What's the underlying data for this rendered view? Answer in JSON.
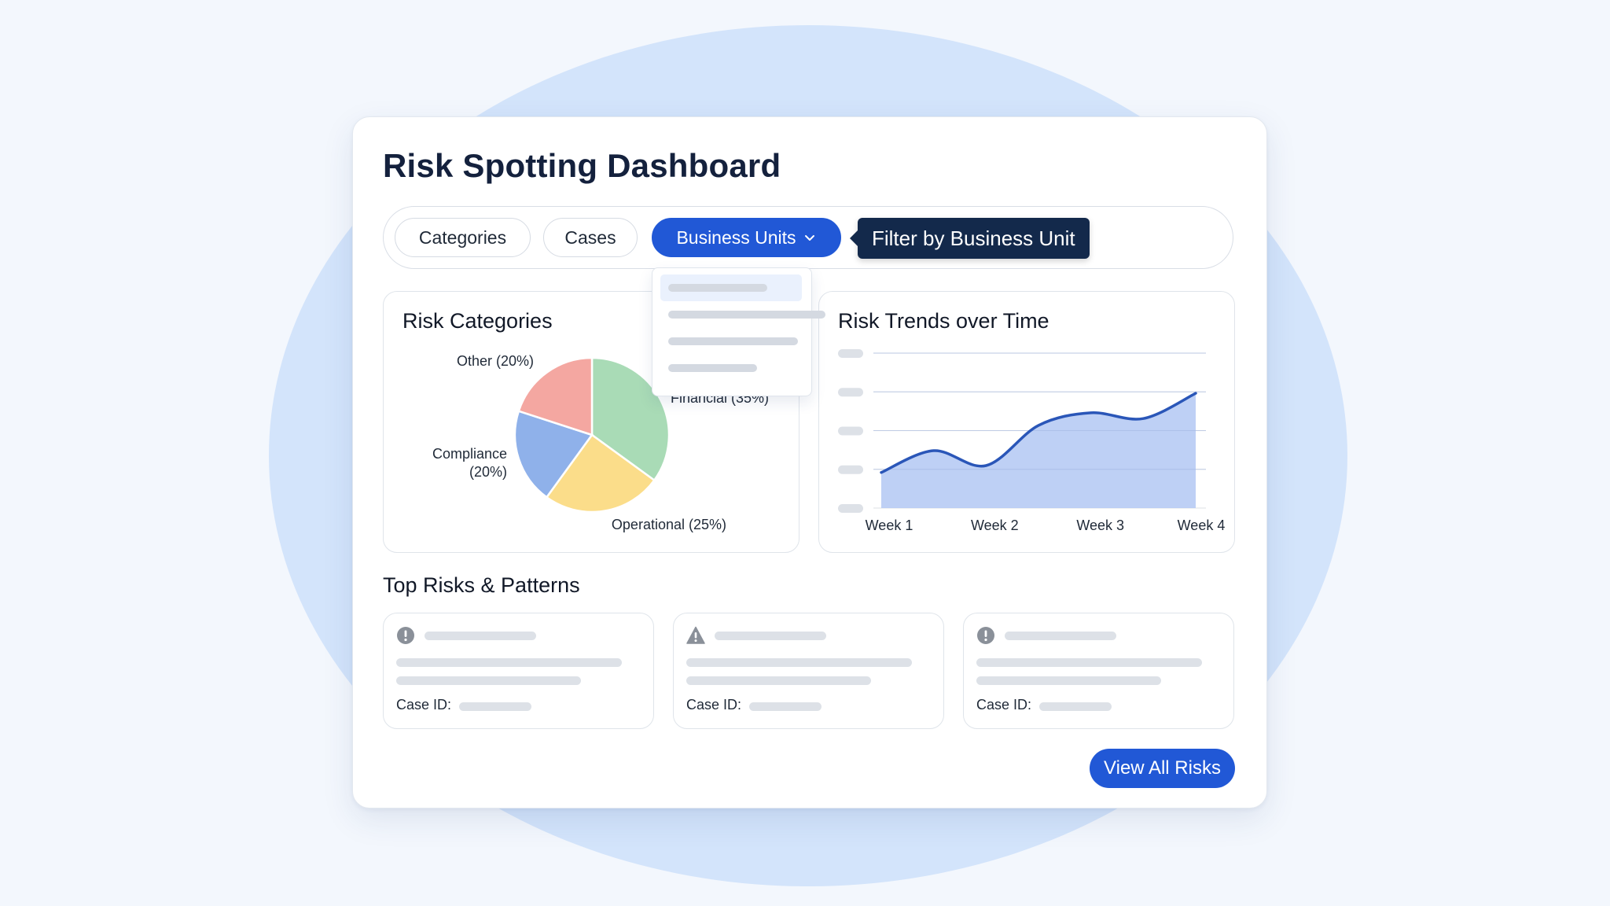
{
  "dashboard": {
    "title": "Risk Spotting Dashboard"
  },
  "filters": {
    "chips": [
      "Categories",
      "Cases",
      "Business Units"
    ],
    "active_chip": "Business Units",
    "tooltip": "Filter by Business Unit"
  },
  "risk_categories_panel": {
    "title": "Risk Categories"
  },
  "risk_trends_panel": {
    "title": "Risk Trends over Time"
  },
  "top_risks": {
    "title": "Top Risks & Patterns",
    "case_label": "Case ID:",
    "cards": [
      {
        "icon": "exclamation-circle-icon"
      },
      {
        "icon": "warning-triangle-icon"
      },
      {
        "icon": "exclamation-circle-icon"
      }
    ]
  },
  "actions": {
    "view_all": "View All Risks"
  },
  "colors": {
    "primary": "#2158d6",
    "tooltip_bg": "#13294b",
    "financial": "#a9dbb6",
    "operational": "#fbdd8a",
    "compliance": "#8fb1ea",
    "other": "#f4a7a1",
    "trend_line": "#2a56b8",
    "trend_fill": "#b3c8f3"
  },
  "chart_data": [
    {
      "type": "pie",
      "title": "Risk Categories",
      "slices": [
        {
          "label": "Financial (35%)",
          "value": 35
        },
        {
          "label": "Operational (25%)",
          "value": 25
        },
        {
          "label": "Compliance (20%)",
          "value": 20
        },
        {
          "label": "Other (20%)",
          "value": 20
        }
      ]
    },
    {
      "type": "area",
      "title": "Risk Trends over Time",
      "categories": [
        "Week 1",
        "Week 2",
        "Week 3",
        "Week 4"
      ],
      "x": [
        1,
        1.5,
        2,
        2.5,
        3,
        3.5,
        4
      ],
      "series": [
        {
          "values": [
            0.31,
            0.5,
            0.37,
            0.72,
            0.83,
            0.78,
            1.0
          ]
        }
      ],
      "ylim": [
        0,
        1.35
      ],
      "grid": true
    }
  ]
}
